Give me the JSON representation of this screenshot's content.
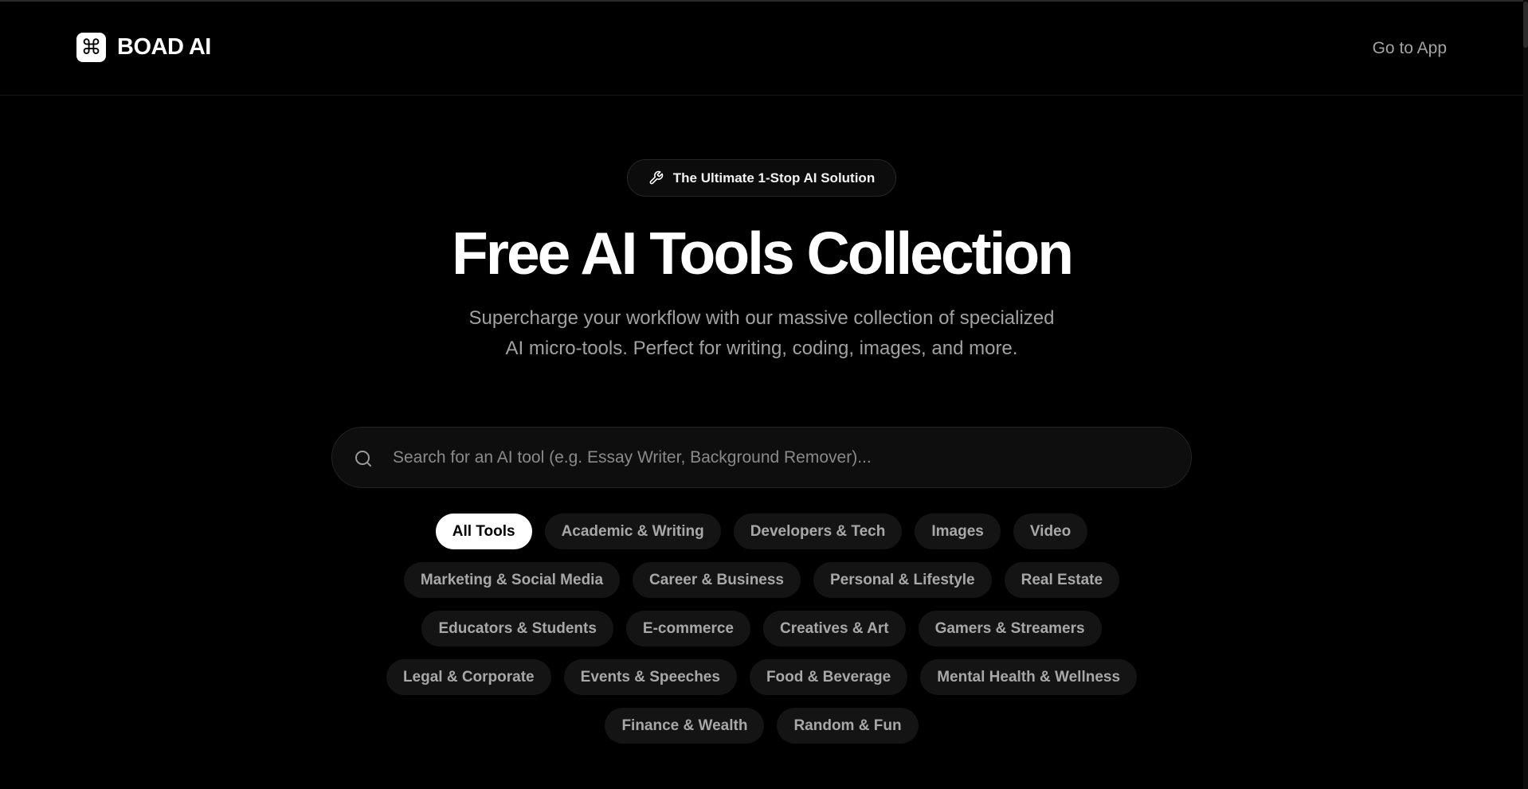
{
  "header": {
    "brand_icon": "command-icon",
    "brand_name": "BOAD AI",
    "go_to_app": "Go to App"
  },
  "hero": {
    "badge_icon": "wrench-icon",
    "badge": "The Ultimate 1-Stop AI Solution",
    "title": "Free AI Tools Collection",
    "subtitle_line1": "Supercharge your workflow with our massive collection of specialized",
    "subtitle_line2": "AI micro-tools. Perfect for writing, coding, images, and more."
  },
  "search": {
    "icon": "search-icon",
    "placeholder": "Search for an AI tool (e.g. Essay Writer, Background Remover)...",
    "value": ""
  },
  "categories": {
    "active": "All Tools",
    "rows": [
      [
        "All Tools",
        "Academic & Writing",
        "Developers & Tech",
        "Images",
        "Video"
      ],
      [
        "Marketing & Social Media",
        "Career & Business",
        "Personal & Lifestyle",
        "Real Estate"
      ],
      [
        "Educators & Students",
        "E-commerce",
        "Creatives & Art",
        "Gamers & Streamers"
      ],
      [
        "Legal & Corporate",
        "Events & Speeches",
        "Food & Beverage",
        "Mental Health & Wellness"
      ],
      [
        "Finance & Wealth",
        "Random & Fun"
      ]
    ]
  },
  "colors": {
    "background": "#000000",
    "text": "#ffffff",
    "muted": "#a1a1a1",
    "chip_bg": "#141414",
    "chip_active_bg": "#ffffff"
  }
}
